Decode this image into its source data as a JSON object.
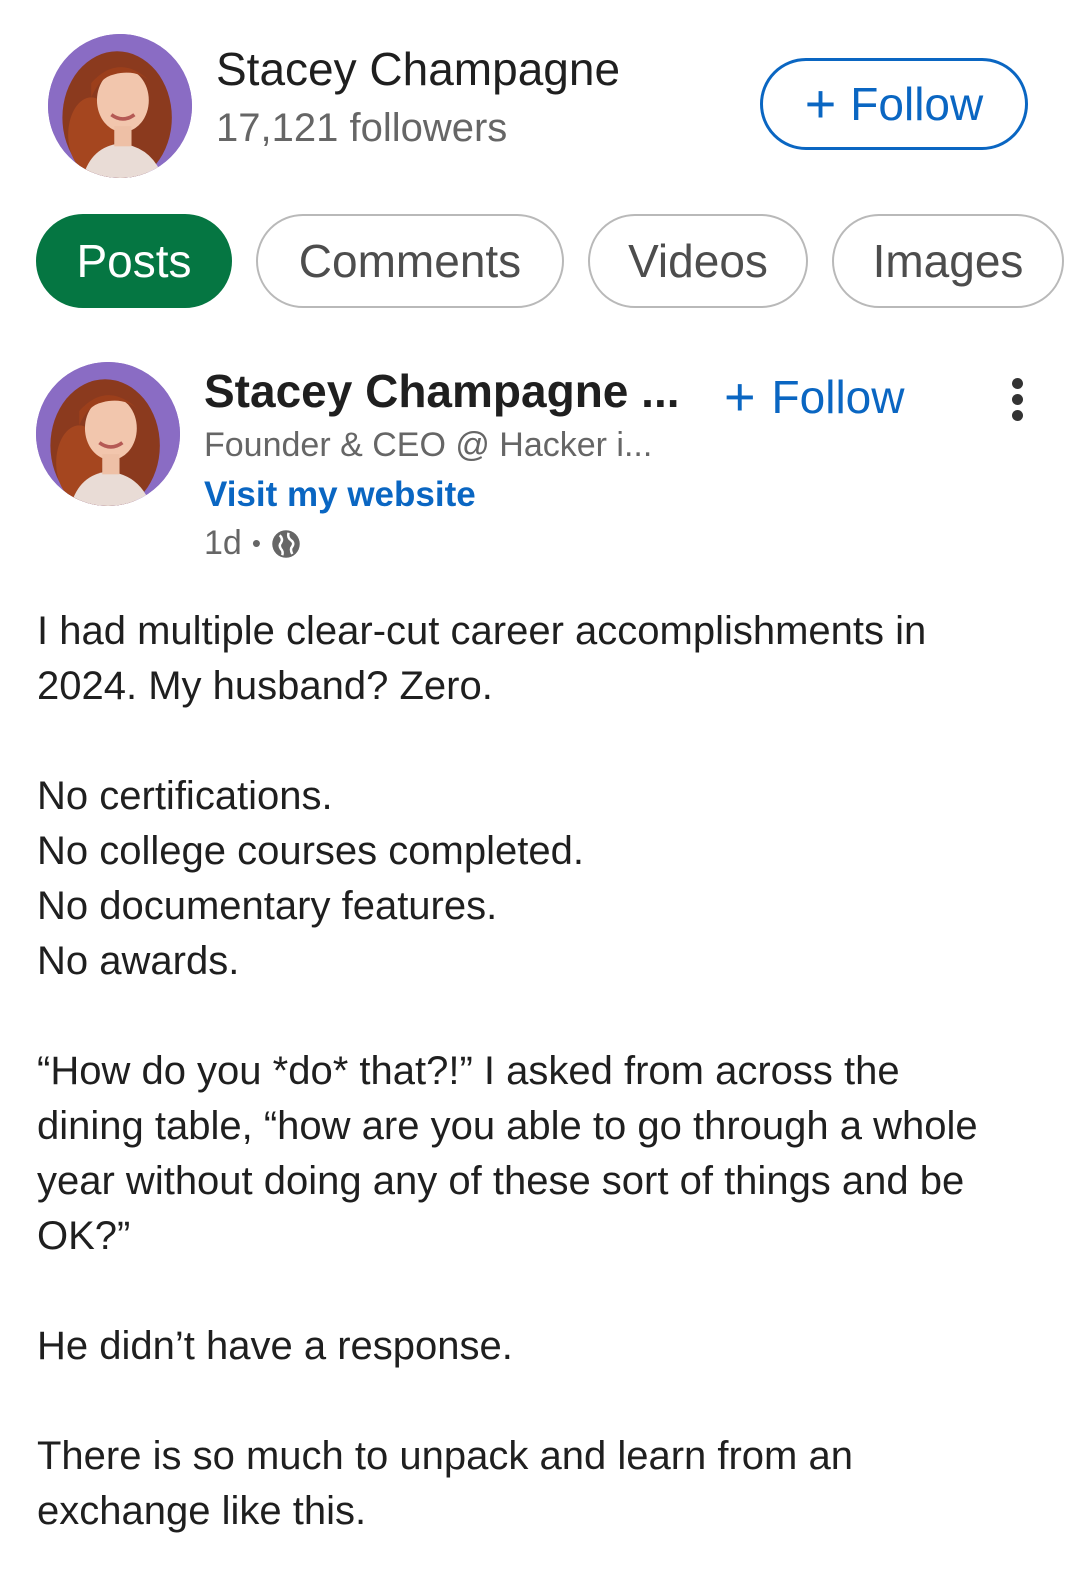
{
  "profile": {
    "name": "Stacey Champagne",
    "followers": "17,121 followers",
    "follow_label": "Follow"
  },
  "tabs": [
    {
      "label": "Posts",
      "active": true
    },
    {
      "label": "Comments",
      "active": false
    },
    {
      "label": "Videos",
      "active": false
    },
    {
      "label": "Images",
      "active": false
    }
  ],
  "post": {
    "author": "Stacey Champagne ...",
    "follow_label": "Follow",
    "headline": "Founder & CEO @ Hacker i...",
    "link_text": "Visit my website",
    "time": "1d",
    "visibility_icon": "globe-icon",
    "paragraphs": [
      [
        "I had multiple clear-cut career accomplishments in",
        "2024. My husband? Zero."
      ],
      [
        "No certifications.",
        "No college courses completed.",
        "No documentary features.",
        "No awards."
      ],
      [
        "“How do you *do* that?!” I asked from across the",
        "dining table, “how are you able to go through a whole",
        "year without doing any of these sort of things and be",
        "OK?”"
      ],
      [
        "He didn’t have a response."
      ],
      [
        "There is so much to unpack and learn from an",
        "exchange like this."
      ]
    ]
  },
  "colors": {
    "brand_blue": "#0a66c2",
    "active_tab_green": "#057642",
    "muted_text": "#666666"
  }
}
